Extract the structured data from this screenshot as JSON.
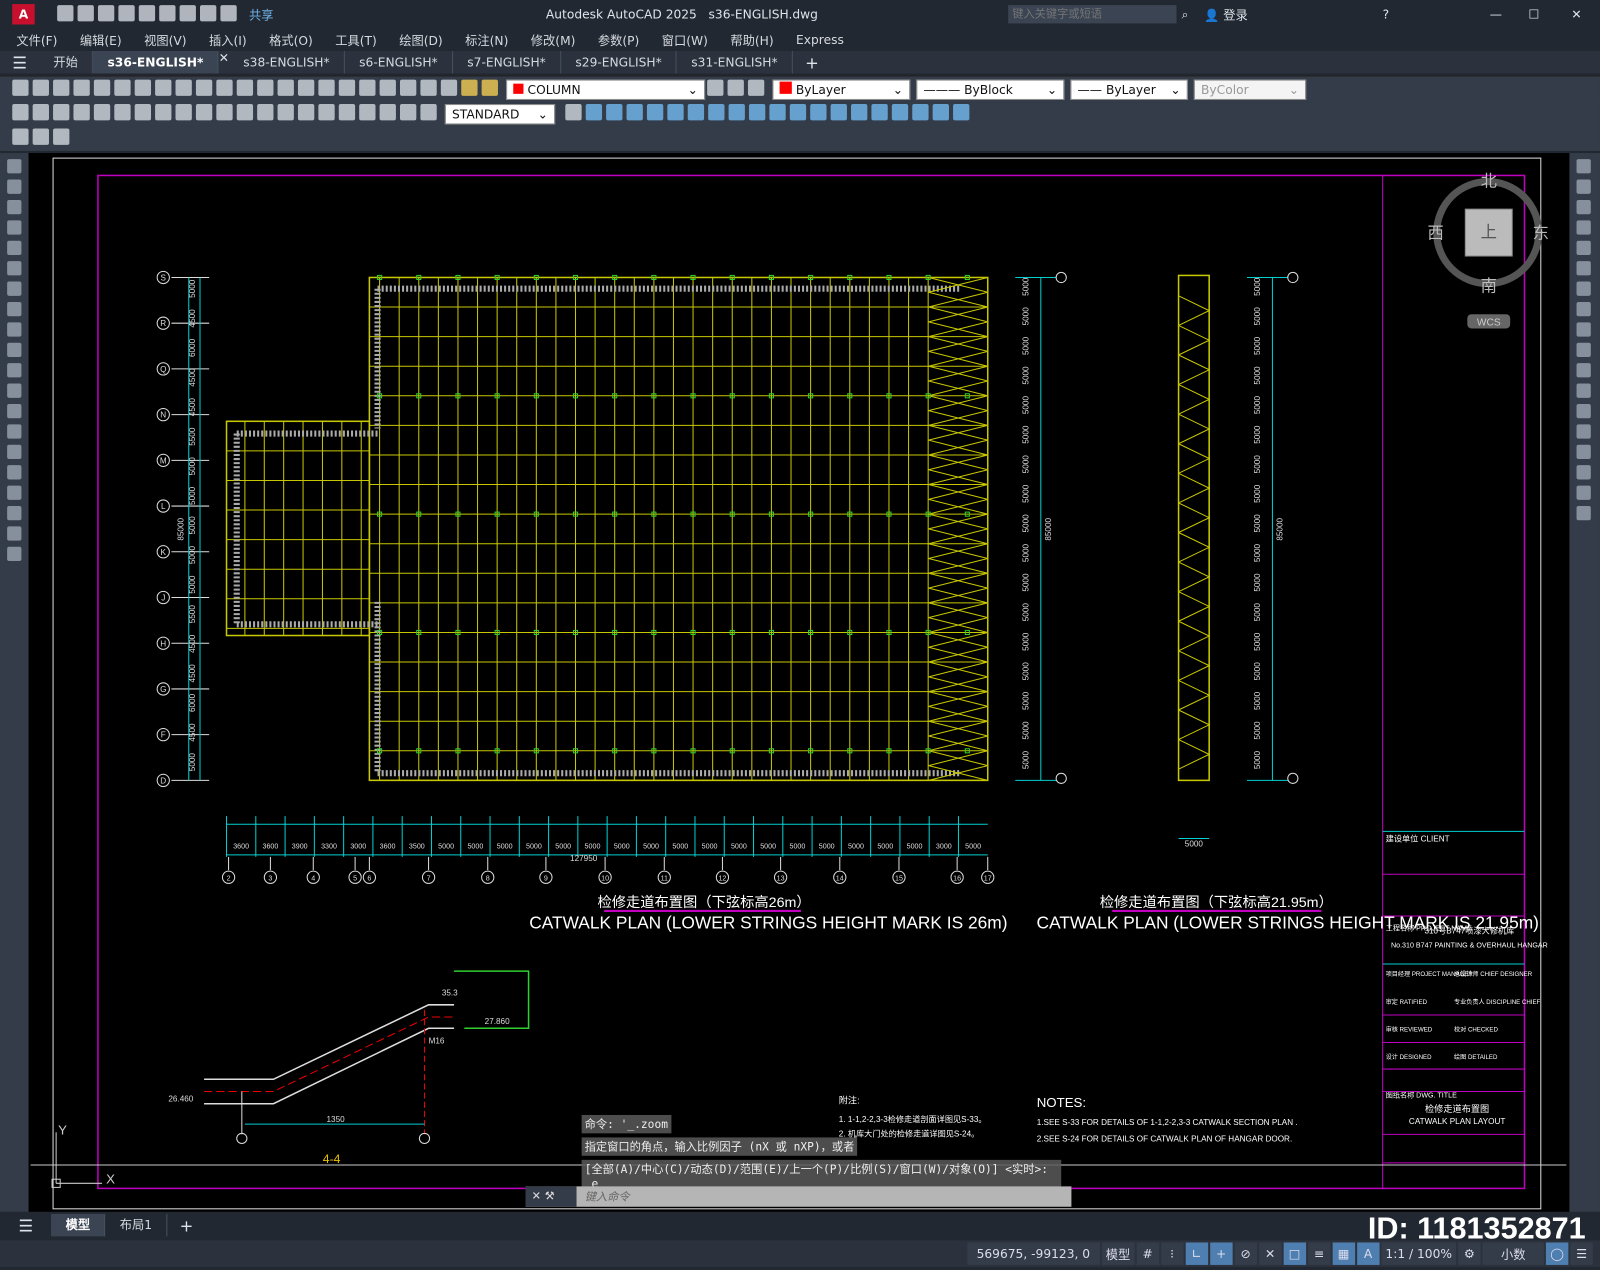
{
  "app": {
    "title": "Autodesk AutoCAD 2025",
    "file": "s36-ENGLISH.dwg",
    "share": "共享",
    "search_placeholder": "键入关键字或短语",
    "login": "登录"
  },
  "menu": [
    "文件(F)",
    "编辑(E)",
    "视图(V)",
    "插入(I)",
    "格式(O)",
    "工具(T)",
    "绘图(D)",
    "标注(N)",
    "修改(M)",
    "参数(P)",
    "窗口(W)",
    "帮助(H)",
    "Express"
  ],
  "tabs": {
    "start": "开始",
    "items": [
      "s36-ENGLISH*",
      "s38-ENGLISH*",
      "s6-ENGLISH*",
      "s7-ENGLISH*",
      "s29-ENGLISH*",
      "s31-ENGLISH*"
    ],
    "active": 0
  },
  "toolbar": {
    "layer": "COLUMN",
    "color": "ByLayer",
    "linetype": "ByBlock",
    "lineweight": "ByLayer",
    "plotstyle": "ByColor",
    "textstyle": "STANDARD",
    "color_swatch": "#ff0000"
  },
  "viewcube": {
    "north": "北",
    "south": "南",
    "east": "东",
    "west": "西",
    "top": "上",
    "wcs": "WCS"
  },
  "drawing": {
    "plan1_cn": "检修走道布置图（下弦标高26m）",
    "plan1_en": "CATWALK PLAN (LOWER STRINGS HEIGHT MARK IS 26m)",
    "plan2_cn": "检修走道布置图（下弦标高21.95m）",
    "plan2_en": "CATWALK PLAN (LOWER STRINGS HEIGHT MARK IS 21.95m)",
    "section": "4-4",
    "total_dim": "127950",
    "total_dim_v": "85000",
    "dim_5000": "5000",
    "bottom_axes": [
      "2",
      "3",
      "4",
      "5",
      "6",
      "7",
      "8",
      "9",
      "10",
      "11",
      "12",
      "13",
      "14",
      "15",
      "16",
      "17"
    ],
    "bottom_dims": [
      "3600",
      "3600",
      "3900",
      "3300",
      "3000",
      "3600",
      "3500",
      "5000",
      "5000",
      "5000",
      "5000",
      "5000",
      "5000",
      "5000",
      "5000",
      "5000",
      "5000",
      "5000",
      "5000",
      "5000",
      "5000",
      "5000",
      "5000",
      "5000",
      "3000",
      "5000"
    ],
    "left_axes": [
      "S",
      "R",
      "Q",
      "N",
      "M",
      "L",
      "K",
      "J",
      "H",
      "G",
      "F",
      "D"
    ],
    "left_dims": [
      "5000",
      "4500",
      "6000",
      "4500",
      "4500",
      "5500",
      "5000",
      "5000",
      "5000",
      "5000",
      "5000",
      "5500",
      "4500",
      "4500",
      "6000",
      "4500",
      "5000"
    ],
    "section_labels": [
      "26.460",
      "1350",
      "27.860",
      "M16",
      "35.3"
    ],
    "notes_cn_title": "附注:",
    "notes_cn": [
      "1. 1-1,2-2,3-3检修走道剖面详图见S-33。",
      "2. 机库大门处的检修走道详图见S-24。"
    ],
    "notes_title": "NOTES:",
    "notes": [
      "1.SEE S-33 FOR DETAILS OF 1-1,2-2,3-3 CATWALK SECTION PLAN .",
      "2.SEE S-24 FOR DETAILS OF CATWALK PLAN OF HANGAR DOOR."
    ],
    "titleblock": {
      "client": "建设单位 CLIENT",
      "project_label": "工程名称 PROJECT NAME",
      "project": "310号B747喷漆大修机库",
      "project_en": "No.310 B747 PAINTING & OVERHAUL HANGAR",
      "rows": [
        "项目经理 PROJECT MANAGER",
        "总设计师 CHIEF DESIGNER",
        "审定 RATIFIED",
        "专业负责人 DISCIPLINE CHIEF",
        "审核 REVIEWED",
        "校对 CHECKED",
        "设计 DESIGNED",
        "绘图 DETAILED"
      ],
      "dwg_title_label": "图纸名称 DWG. TITLE",
      "dwg_title": "检修走道布置图",
      "dwg_title_en": "CATWALK PLAN LAYOUT"
    }
  },
  "command": {
    "history": [
      "命令: '_.zoom",
      "指定窗口的角点，输入比例因子 (nX 或 nXP)，或者",
      "[全部(A)/中心(C)/动态(D)/范围(E)/上一个(P)/比例(S)/窗口(W)/对象(O)] <实时>:",
      "_e"
    ],
    "placeholder": "键入命令"
  },
  "layouts": [
    "模型",
    "布局1"
  ],
  "status": {
    "coords": "569675, -99123, 0",
    "model": "模型",
    "scale": "1:1 / 100%",
    "units": "小数"
  },
  "watermark_id": "ID: 1181352871"
}
